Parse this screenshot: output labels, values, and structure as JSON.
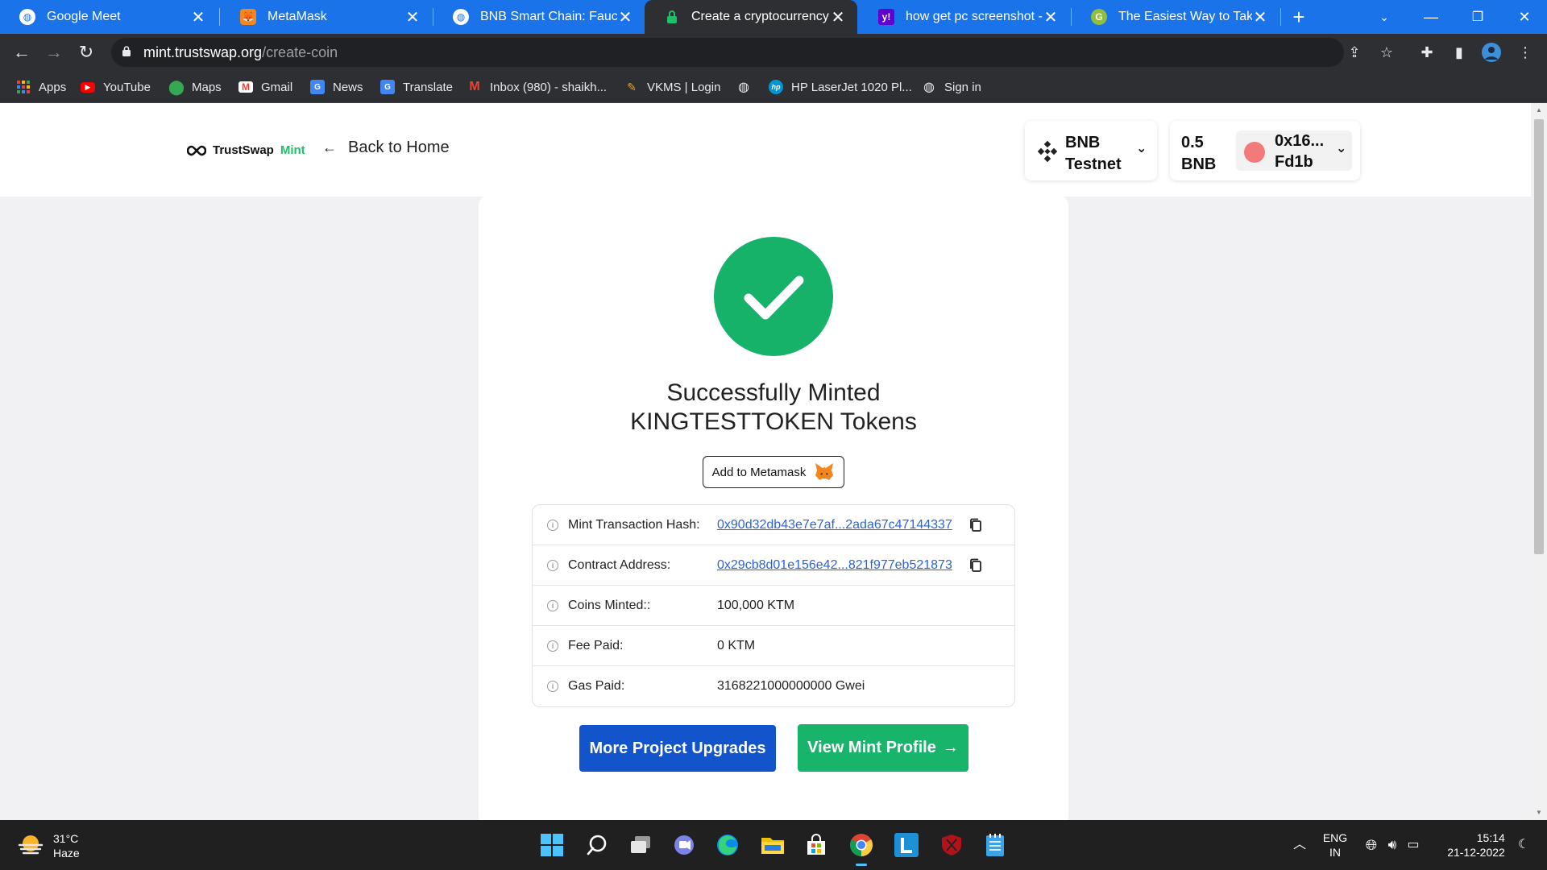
{
  "browser": {
    "tabs": [
      {
        "title": "Google Meet",
        "icon": "globe-icon"
      },
      {
        "title": "MetaMask",
        "icon": "metamask-fox-icon"
      },
      {
        "title": "BNB Smart Chain: Faucet",
        "icon": "globe-icon"
      },
      {
        "title": "Create a cryptocurrency tok",
        "icon": "lock-icon",
        "active": true
      },
      {
        "title": "how get pc screenshot - Ya",
        "icon": "yahoo-icon"
      },
      {
        "title": "The Easiest Way to Take a S",
        "icon": "site-icon"
      }
    ],
    "new_tab": "+",
    "url_host": "mint.trustswap.org",
    "url_path": "/create-coin",
    "bookmarks": [
      {
        "label": "Apps",
        "icon": "apps-grid-icon"
      },
      {
        "label": "YouTube",
        "icon": "youtube-icon"
      },
      {
        "label": "Maps",
        "icon": "maps-pin-icon"
      },
      {
        "label": "Gmail",
        "icon": "gmail-icon"
      },
      {
        "label": "News",
        "icon": "news-icon"
      },
      {
        "label": "Translate",
        "icon": "translate-icon"
      },
      {
        "label": "Inbox (980) - shaikh...",
        "icon": "gmail-icon"
      },
      {
        "label": "VKMS | Login",
        "icon": "vkms-icon"
      },
      {
        "label": "",
        "icon": "globe-icon"
      },
      {
        "label": "HP LaserJet 1020 Pl...",
        "icon": "hp-icon"
      },
      {
        "label": "Sign in",
        "icon": "globe-icon"
      }
    ]
  },
  "header": {
    "logo_text": "TrustSwap",
    "logo_mint": "Mint",
    "back_label": "Back to Home",
    "network_line1": "BNB",
    "network_line2": "Testnet",
    "balance_line1": "0.5",
    "balance_line2": "BNB",
    "address_line1": "0x16...",
    "address_line2": "Fd1b"
  },
  "result": {
    "headline": "Successfully Minted KINGTESTTOKEN Tokens",
    "add_metamask_label": "Add to Metamask",
    "rows": [
      {
        "label": "Mint Transaction Hash:",
        "value": "0x90d32db43e7e7af...2ada67c47144337",
        "link": true
      },
      {
        "label": "Contract Address:",
        "value": "0x29cb8d01e156e42...821f977eb521873",
        "link": true
      },
      {
        "label": "Coins Minted::",
        "value": "100,000 KTM"
      },
      {
        "label": "Fee Paid:",
        "value": "0 KTM"
      },
      {
        "label": "Gas Paid:",
        "value": "3168221000000000 Gwei"
      }
    ],
    "upgrades_label": "More Project Upgrades",
    "profile_label": "View Mint Profile",
    "profile_arrow": "→"
  },
  "taskbar": {
    "temperature": "31°C",
    "condition": "Haze",
    "lang_line1": "ENG",
    "lang_line2": "IN",
    "time": "15:14",
    "date": "21-12-2022"
  },
  "colors": {
    "tabbar": "#1a73e8",
    "success_green": "#17b26a",
    "primary_blue": "#1154cc",
    "link_blue": "#2b64d6"
  }
}
